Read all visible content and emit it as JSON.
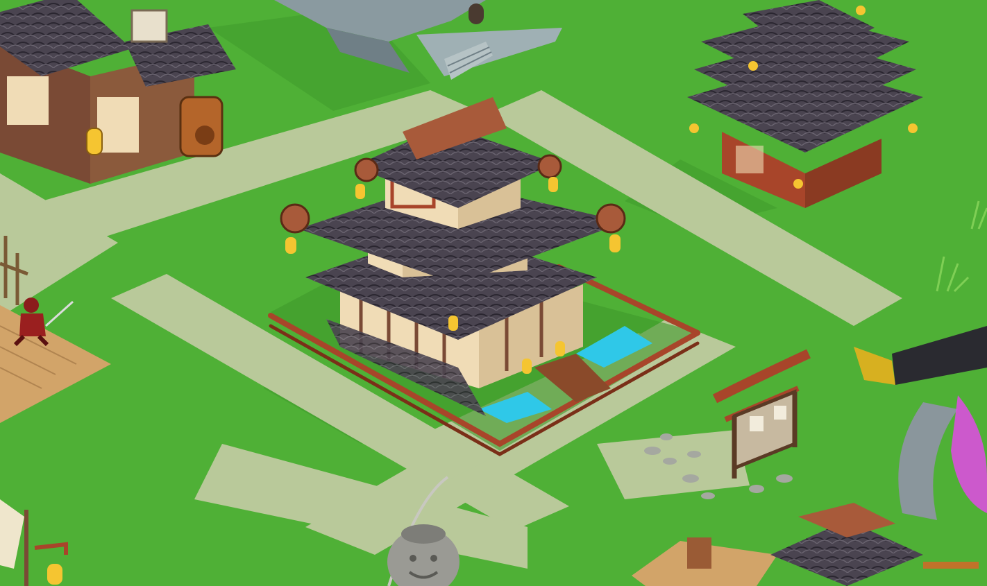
{
  "scene": {
    "type": "isometric-village-map",
    "theme": "feudal-japan",
    "hud_text": []
  },
  "palette": {
    "grass": "#4fb036",
    "grass_dark": "#3f9a2c",
    "path": "#b9c99a",
    "path_edge": "#a9bd86",
    "roof_tile": "#4a4450",
    "roof_tile_light": "#6a6470",
    "wood_red": "#a8452a",
    "wood_brown": "#7a4a35",
    "wall_cream": "#f0dcb6",
    "water": "#2fc8e8",
    "lantern": "#f5c531",
    "stone": "#8a9aa0",
    "deck": "#d2a469",
    "portal_glow": "#e24ae6"
  },
  "objects": {
    "pagoda_main": {
      "kind": "building",
      "icon": "pagoda-icon"
    },
    "tavern": {
      "kind": "building",
      "icon": "tavern-icon"
    },
    "pagoda_tower": {
      "kind": "building",
      "icon": "tower-icon"
    },
    "stone_fort": {
      "kind": "building",
      "icon": "fort-icon"
    },
    "notice_board": {
      "kind": "signboard",
      "icon": "notice-board-icon"
    },
    "shrine_small": {
      "kind": "building",
      "icon": "shrine-icon"
    },
    "samurai": {
      "kind": "unit",
      "icon": "samurai-icon"
    },
    "stone_statue": {
      "kind": "decoration",
      "icon": "statue-icon"
    },
    "sword_portal": {
      "kind": "portal",
      "icon": "sword-icon"
    },
    "dock": {
      "kind": "terrain",
      "icon": "dock-icon"
    }
  }
}
